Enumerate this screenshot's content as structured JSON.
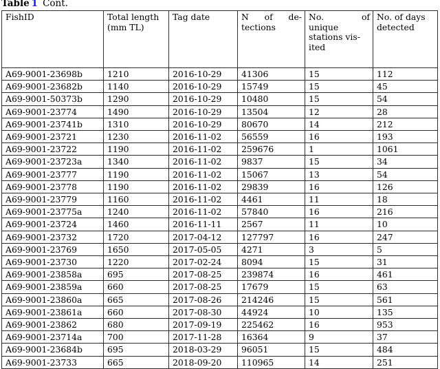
{
  "caption": {
    "label": "Table",
    "number": "1",
    "continuation": "Cont.",
    "number_color": "#1a19e0"
  },
  "table": {
    "name": "fish-detections-table",
    "columns": [
      {
        "id": "fish_id",
        "header": "FishID",
        "header_lines": [
          "FishID"
        ]
      },
      {
        "id": "total_length",
        "header": "Total length (mm TL)",
        "header_lines": [
          "Total length",
          "(mm TL)"
        ]
      },
      {
        "id": "tag_date",
        "header": "Tag date",
        "header_lines": [
          "Tag date"
        ]
      },
      {
        "id": "no_detections",
        "header": "No. of detections",
        "header_lines": [
          "No.  of  de-",
          "tections"
        ]
      },
      {
        "id": "no_unique_stations",
        "header": "No. of unique stations visited",
        "header_lines": [
          "No.          of",
          "unique",
          "stations vis-",
          "ited"
        ]
      },
      {
        "id": "no_days_detected",
        "header": "No. of days detected",
        "header_lines": [
          "No. of days",
          "detected"
        ]
      }
    ],
    "rows": [
      [
        "A69-9001-23698b",
        "1210",
        "2016-10-29",
        "41306",
        "15",
        "112"
      ],
      [
        "A69-9001-23682b",
        "1140",
        "2016-10-29",
        "15749",
        "15",
        "45"
      ],
      [
        "A69-9001-50373b",
        "1290",
        "2016-10-29",
        "10480",
        "15",
        "54"
      ],
      [
        "A69-9001-23774",
        "1490",
        "2016-10-29",
        "13504",
        "12",
        "28"
      ],
      [
        "A69-9001-23741b",
        "1310",
        "2016-10-29",
        "80670",
        "14",
        "212"
      ],
      [
        "A69-9001-23721",
        "1230",
        "2016-11-02",
        "56559",
        "16",
        "193"
      ],
      [
        "A69-9001-23722",
        "1190",
        "2016-11-02",
        "259676",
        "1",
        "1061"
      ],
      [
        "A69-9001-23723a",
        "1340",
        "2016-11-02",
        "9837",
        "15",
        "34"
      ],
      [
        "A69-9001-23777",
        "1190",
        "2016-11-02",
        "15067",
        "13",
        "54"
      ],
      [
        "A69-9001-23778",
        "1190",
        "2016-11-02",
        "29839",
        "16",
        "126"
      ],
      [
        "A69-9001-23779",
        "1160",
        "2016-11-02",
        "4461",
        "11",
        "18"
      ],
      [
        "A69-9001-23775a",
        "1240",
        "2016-11-02",
        "57840",
        "16",
        "216"
      ],
      [
        "A69-9001-23724",
        "1460",
        "2016-11-11",
        "2567",
        "11",
        "10"
      ],
      [
        "A69-9001-23732",
        "1720",
        "2017-04-12",
        "127797",
        "16",
        "247"
      ],
      [
        "A69-9001-23769",
        "1650",
        "2017-05-05",
        "4271",
        "3",
        "5"
      ],
      [
        "A69-9001-23730",
        "1220",
        "2017-02-24",
        "8094",
        "15",
        "31"
      ],
      [
        "A69-9001-23858a",
        "695",
        "2017-08-25",
        "239874",
        "16",
        "461"
      ],
      [
        "A69-9001-23859a",
        "660",
        "2017-08-25",
        "17679",
        "15",
        "63"
      ],
      [
        "A69-9001-23860a",
        "665",
        "2017-08-26",
        "214246",
        "15",
        "561"
      ],
      [
        "A69-9001-23861a",
        "660",
        "2017-08-30",
        "44924",
        "10",
        "135"
      ],
      [
        "A69-9001-23862",
        "680",
        "2017-09-19",
        "225462",
        "16",
        "953"
      ],
      [
        "A69-9001-23714a",
        "700",
        "2017-11-28",
        "16364",
        "9",
        "37"
      ],
      [
        "A69-9001-23684b",
        "695",
        "2018-03-29",
        "96051",
        "15",
        "484"
      ],
      [
        "A69-9001-23733",
        "665",
        "2018-09-20",
        "110965",
        "14",
        "251"
      ]
    ]
  }
}
